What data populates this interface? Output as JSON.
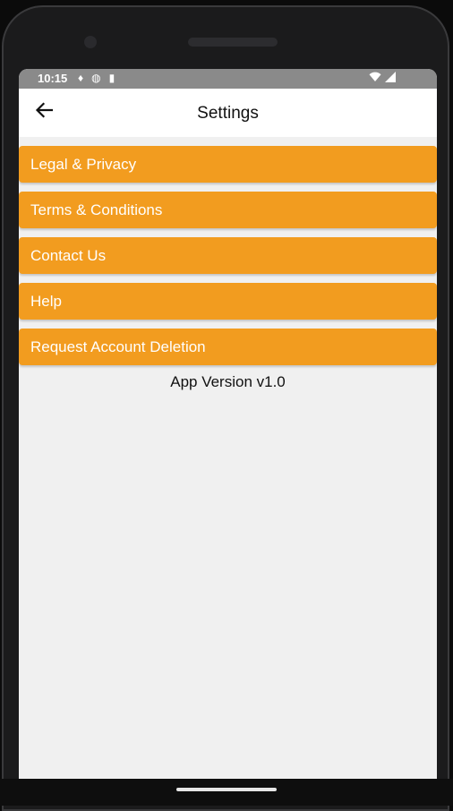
{
  "status_bar": {
    "time": "10:15",
    "left_icons": [
      "data-saver-icon",
      "vpn-icon",
      "sd-card-icon"
    ],
    "right_icons": [
      "wifi-icon",
      "signal-icon"
    ]
  },
  "header": {
    "back_icon": "arrow-left-icon",
    "title": "Settings"
  },
  "menu": {
    "items": [
      {
        "label": "Legal & Privacy"
      },
      {
        "label": "Terms & Conditions"
      },
      {
        "label": "Contact Us"
      },
      {
        "label": "Help"
      },
      {
        "label": "Request Account Deletion"
      }
    ]
  },
  "footer": {
    "version_text": "App Version v1.0"
  },
  "colors": {
    "accent": "#f29c1f",
    "background": "#f0f0f0",
    "appbar": "#ffffff",
    "status_bar": "#8a8a8a"
  }
}
